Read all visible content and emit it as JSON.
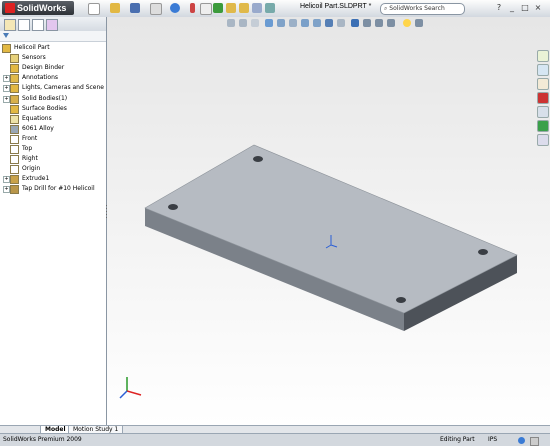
{
  "app": {
    "logo_text": "SolidWorks",
    "document_title": "Helicoil Part.SLDPRT *",
    "search_placeholder": "SolidWorks Search",
    "help_label": "?",
    "minimize_label": "_",
    "restore_label": "□",
    "close_label": "×"
  },
  "feature_tree": {
    "items": [
      {
        "label": "Helicoil Part",
        "icon": "part-icon",
        "level": 0,
        "expandable": false
      },
      {
        "label": "Sensors",
        "icon": "sensors-icon",
        "level": 1,
        "expandable": false
      },
      {
        "label": "Design Binder",
        "icon": "design-binder-icon",
        "level": 1,
        "expandable": false
      },
      {
        "label": "Annotations",
        "icon": "annotations-icon",
        "level": 1,
        "expandable": true
      },
      {
        "label": "Lights, Cameras and Scene",
        "icon": "lights-icon",
        "level": 1,
        "expandable": true
      },
      {
        "label": "Solid Bodies(1)",
        "icon": "solid-bodies-icon",
        "level": 1,
        "expandable": true
      },
      {
        "label": "Surface Bodies",
        "icon": "surface-bodies-icon",
        "level": 1,
        "expandable": false
      },
      {
        "label": "Equations",
        "icon": "equations-icon",
        "level": 1,
        "expandable": false
      },
      {
        "label": "6061 Alloy",
        "icon": "material-icon",
        "level": 1,
        "expandable": false
      },
      {
        "label": "Front",
        "icon": "plane-icon",
        "level": 1,
        "expandable": false
      },
      {
        "label": "Top",
        "icon": "plane-icon",
        "level": 1,
        "expandable": false
      },
      {
        "label": "Right",
        "icon": "plane-icon",
        "level": 1,
        "expandable": false
      },
      {
        "label": "Origin",
        "icon": "origin-icon",
        "level": 1,
        "expandable": false
      },
      {
        "label": "Extrude1",
        "icon": "extrude-icon",
        "level": 1,
        "expandable": true
      },
      {
        "label": "Tap Drill for #10 Helicoil",
        "icon": "hole-icon",
        "level": 1,
        "expandable": true
      }
    ]
  },
  "bottom_tabs": {
    "model": "Model",
    "motion_study": "Motion Study 1"
  },
  "status": {
    "left": "SolidWorks Premium 2009",
    "mode": "Editing Part",
    "units": "IPS"
  },
  "colors": {
    "plate_top": "#b7bcc3",
    "plate_side": "#5e646c",
    "accent": "#4a7bb7"
  }
}
